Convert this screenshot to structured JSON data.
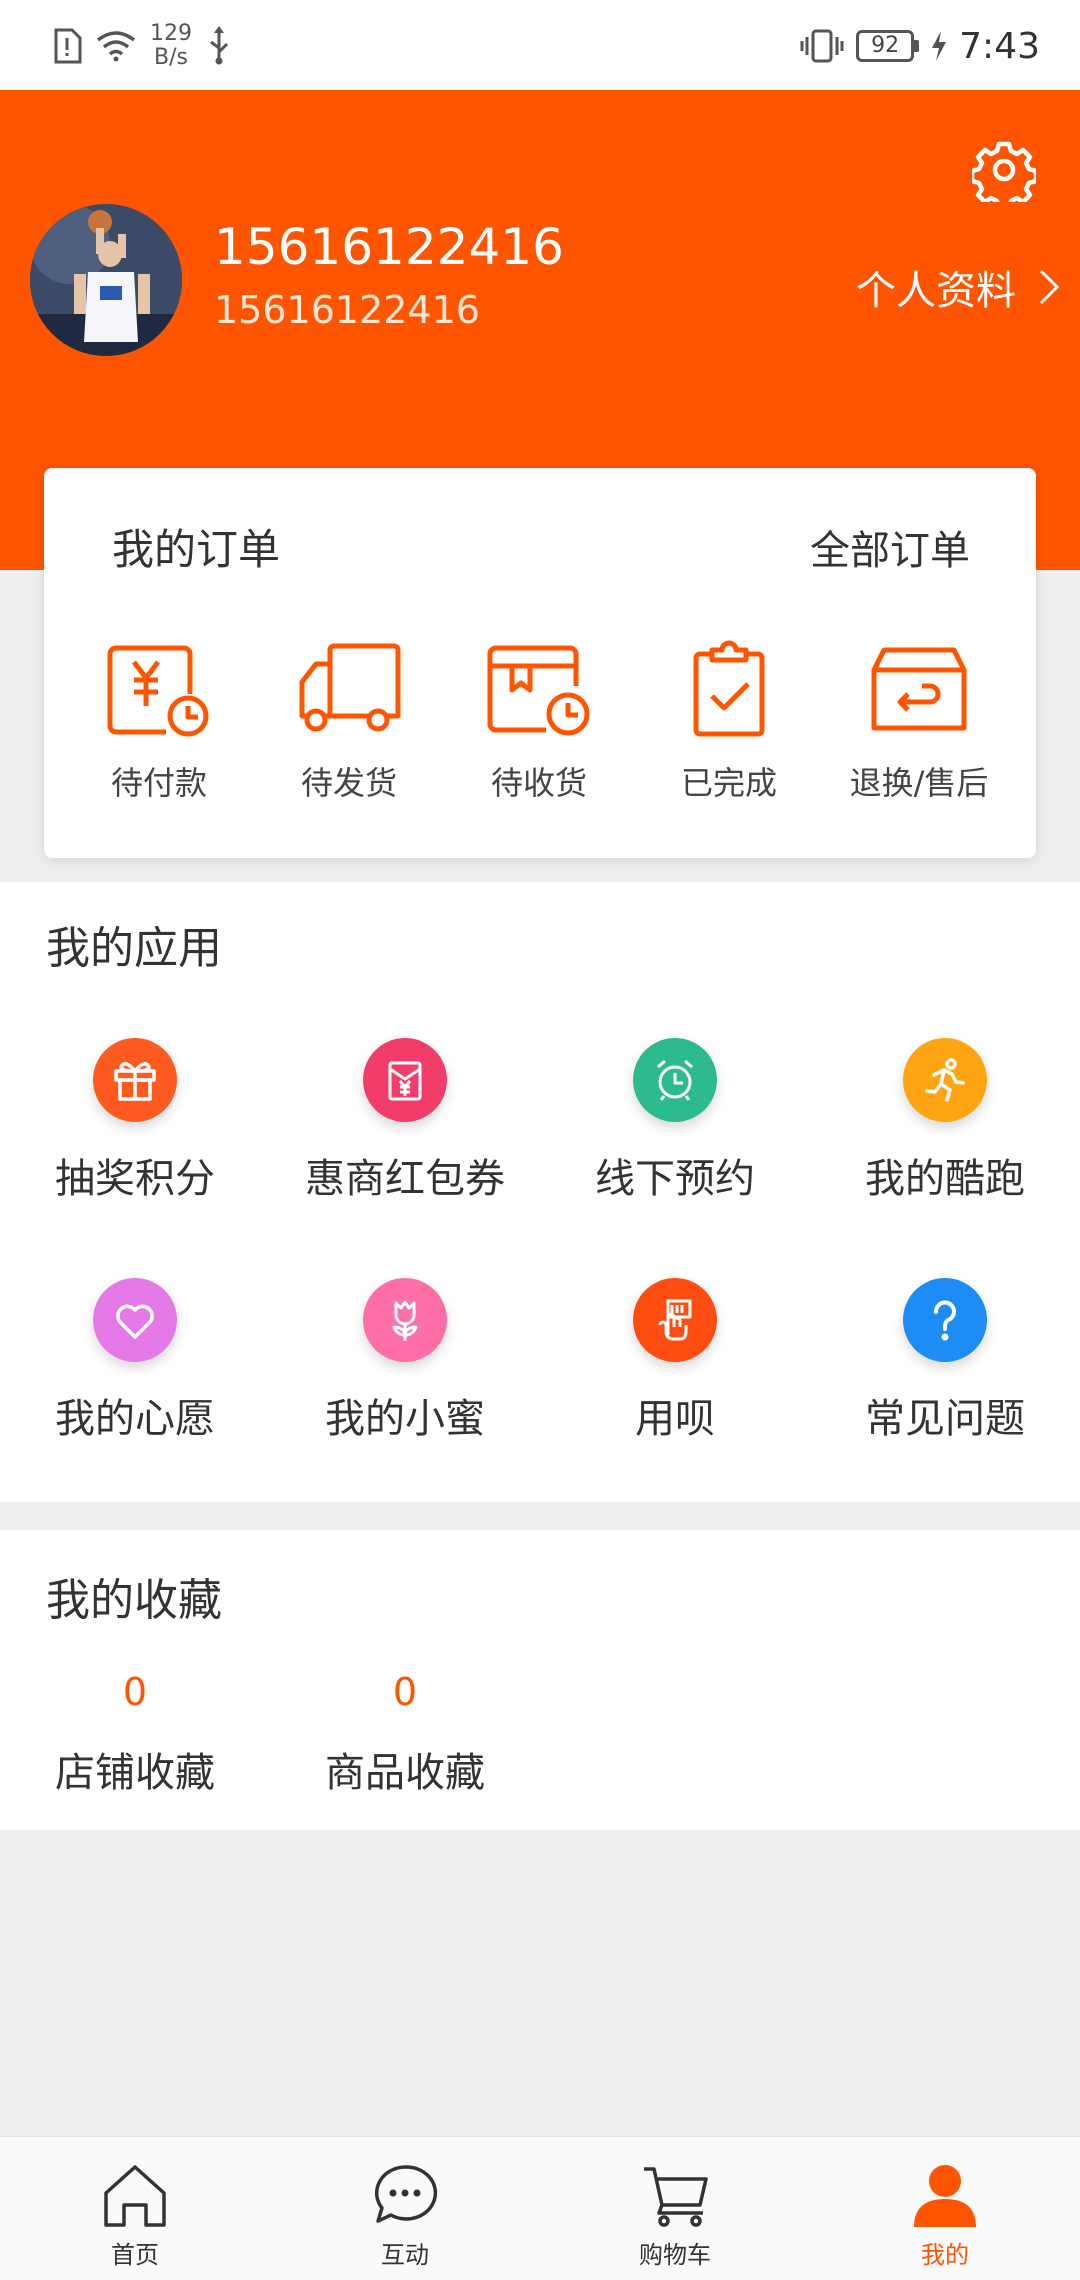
{
  "status_bar": {
    "net_speed_value": "129",
    "net_speed_unit": "B/s",
    "battery": "92",
    "time": "7:43"
  },
  "profile": {
    "name": "15616122416",
    "subtitle": "15616122416",
    "link_label": "个人资料"
  },
  "orders": {
    "title": "我的订单",
    "all_label": "全部订单",
    "items": [
      {
        "label": "待付款",
        "icon": "pending-payment-icon"
      },
      {
        "label": "待发货",
        "icon": "truck-icon"
      },
      {
        "label": "待收货",
        "icon": "package-clock-icon"
      },
      {
        "label": "已完成",
        "icon": "clipboard-check-icon"
      },
      {
        "label": "退换/售后",
        "icon": "return-box-icon"
      }
    ]
  },
  "apps": {
    "title": "我的应用",
    "items": [
      {
        "label": "抽奖积分",
        "icon": "gift-icon",
        "color": "#ff5a1f"
      },
      {
        "label": "惠商红包券",
        "icon": "red-envelope-icon",
        "color": "#f23d6b"
      },
      {
        "label": "线下预约",
        "icon": "alarm-clock-icon",
        "color": "#2cba8f"
      },
      {
        "label": "我的酷跑",
        "icon": "runner-icon",
        "color": "#ffa412"
      },
      {
        "label": "我的心愿",
        "icon": "heart-icon",
        "color": "#e679e8"
      },
      {
        "label": "我的小蜜",
        "icon": "flower-icon",
        "color": "#ff6fa7"
      },
      {
        "label": "用呗",
        "icon": "hand-card-icon",
        "color": "#ff4d12"
      },
      {
        "label": "常见问题",
        "icon": "question-icon",
        "color": "#1e8cf5"
      }
    ]
  },
  "favorites": {
    "title": "我的收藏",
    "items": [
      {
        "count": "0",
        "label": "店铺收藏"
      },
      {
        "count": "0",
        "label": "商品收藏"
      }
    ]
  },
  "bottom_nav": {
    "items": [
      {
        "label": "首页",
        "icon": "home-icon"
      },
      {
        "label": "互动",
        "icon": "chat-icon"
      },
      {
        "label": "购物车",
        "icon": "cart-icon"
      },
      {
        "label": "我的",
        "icon": "user-icon",
        "active": true
      }
    ]
  },
  "colors": {
    "brand": "#ff5500",
    "background": "#eeeeee"
  }
}
